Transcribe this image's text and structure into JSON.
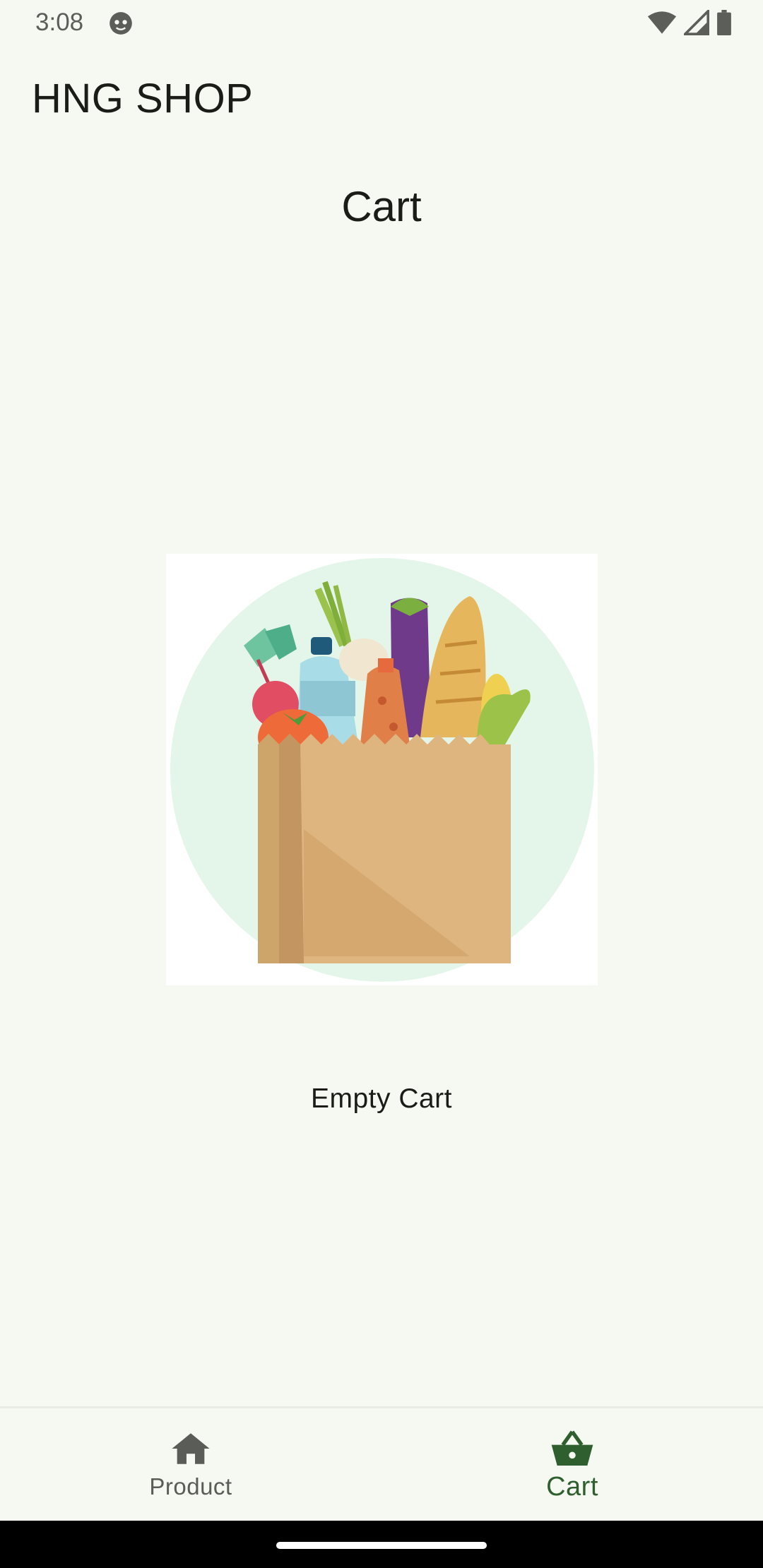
{
  "status_bar": {
    "time": "3:08",
    "icons": [
      "notification-face-icon",
      "wifi-icon",
      "signal-icon",
      "battery-icon"
    ]
  },
  "app": {
    "title": "HNG SHOP"
  },
  "page": {
    "title": "Cart"
  },
  "empty_state": {
    "illustration": "grocery-bag-illustration",
    "message": "Empty Cart"
  },
  "bottom_nav": {
    "items": [
      {
        "label": "Product",
        "icon": "home-icon",
        "selected": false
      },
      {
        "label": "Cart",
        "icon": "basket-icon",
        "selected": true
      }
    ]
  },
  "colors": {
    "background": "#f5f9f1",
    "active_nav": "#2f5f2f",
    "inactive_nav": "#5a5d57"
  }
}
